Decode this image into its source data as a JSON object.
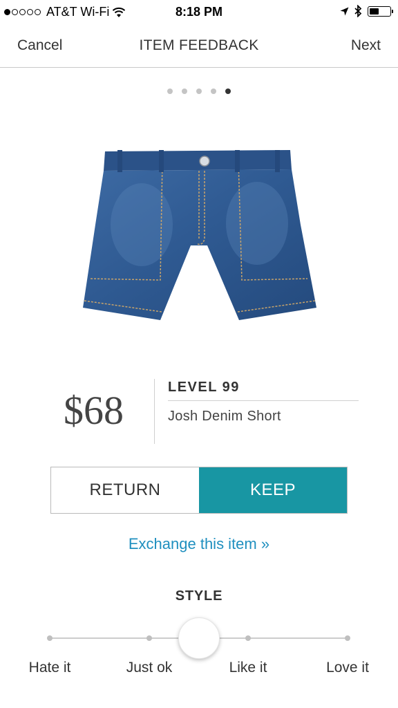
{
  "status_bar": {
    "carrier": "AT&T Wi-Fi",
    "time": "8:18 PM",
    "signal_bars": 1,
    "battery_level": 0.45
  },
  "nav": {
    "left": "Cancel",
    "title": "ITEM FEEDBACK",
    "right": "Next"
  },
  "pager": {
    "total": 5,
    "current": 5
  },
  "product": {
    "price": "$68",
    "brand": "LEVEL 99",
    "name": "Josh Denim Short"
  },
  "actions": {
    "return_label": "RETURN",
    "keep_label": "KEEP",
    "exchange_label": "Exchange this item »"
  },
  "style": {
    "title": "STYLE",
    "options": [
      "Hate it",
      "Just ok",
      "Like it",
      "Love it"
    ],
    "selected_position": 0.5
  },
  "colors": {
    "keep": "#1896a3",
    "link": "#1f8fbf"
  }
}
